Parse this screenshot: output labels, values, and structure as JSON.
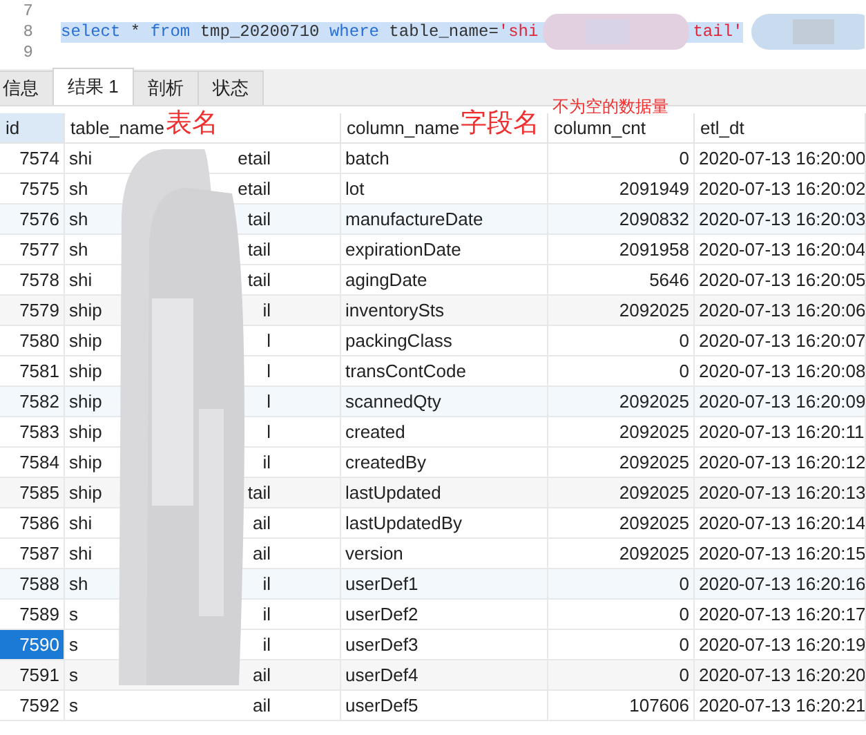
{
  "editor": {
    "lines": [
      {
        "number": "7"
      },
      {
        "number": "8",
        "selected": true,
        "redacted": true,
        "parts": [
          {
            "kind": "keyword",
            "text": "select"
          },
          {
            "kind": "plain",
            "text": " * "
          },
          {
            "kind": "keyword",
            "text": "from"
          },
          {
            "kind": "plain",
            "text": " tmp_20200710 "
          },
          {
            "kind": "keyword",
            "text": "where"
          },
          {
            "kind": "plain",
            "text": " table_name="
          },
          {
            "kind": "string",
            "text": "'shi"
          },
          {
            "kind": "gap"
          },
          {
            "kind": "string",
            "text": "tail'"
          }
        ]
      },
      {
        "number": "9"
      }
    ]
  },
  "tabs": [
    {
      "label": "信息",
      "selected": false
    },
    {
      "label": "结果 1",
      "selected": true
    },
    {
      "label": "剖析",
      "selected": false
    },
    {
      "label": "状态",
      "selected": false
    }
  ],
  "table": {
    "redacted": true,
    "columns": [
      {
        "label": "id",
        "selected": true
      },
      {
        "label": "table_name",
        "selected": false,
        "annotation": "表名"
      },
      {
        "label": "column_name",
        "selected": false,
        "annotation": "字段名"
      },
      {
        "label": "column_cnt",
        "selected": false,
        "note": "不为空的数据量"
      },
      {
        "label": "etl_dt",
        "selected": false
      }
    ],
    "rows": [
      {
        "id": "7574",
        "table_name": [
          "shi",
          "etail"
        ],
        "column_name": "batch",
        "column_cnt": "0",
        "etl_dt": "2020-07-13 16:20:00",
        "selected": false
      },
      {
        "id": "7575",
        "table_name": [
          "sh",
          "etail"
        ],
        "column_name": "lot",
        "column_cnt": "2091949",
        "etl_dt": "2020-07-13 16:20:02",
        "selected": false
      },
      {
        "id": "7576",
        "table_name": [
          "sh",
          "tail"
        ],
        "column_name": "manufactureDate",
        "column_cnt": "2090832",
        "etl_dt": "2020-07-13 16:20:03",
        "selected": false
      },
      {
        "id": "7577",
        "table_name": [
          "sh",
          "tail"
        ],
        "column_name": "expirationDate",
        "column_cnt": "2091958",
        "etl_dt": "2020-07-13 16:20:04",
        "selected": false
      },
      {
        "id": "7578",
        "table_name": [
          "shi",
          "tail"
        ],
        "column_name": "agingDate",
        "column_cnt": "5646",
        "etl_dt": "2020-07-13 16:20:05",
        "selected": false
      },
      {
        "id": "7579",
        "table_name": [
          "ship",
          "il"
        ],
        "column_name": "inventorySts",
        "column_cnt": "2092025",
        "etl_dt": "2020-07-13 16:20:06",
        "selected": false
      },
      {
        "id": "7580",
        "table_name": [
          "ship",
          "l"
        ],
        "column_name": "packingClass",
        "column_cnt": "0",
        "etl_dt": "2020-07-13 16:20:07",
        "selected": false
      },
      {
        "id": "7581",
        "table_name": [
          "ship",
          "l"
        ],
        "column_name": "transContCode",
        "column_cnt": "0",
        "etl_dt": "2020-07-13 16:20:08",
        "selected": false
      },
      {
        "id": "7582",
        "table_name": [
          "ship",
          "l"
        ],
        "column_name": "scannedQty",
        "column_cnt": "2092025",
        "etl_dt": "2020-07-13 16:20:09",
        "selected": false
      },
      {
        "id": "7583",
        "table_name": [
          "ship",
          "l"
        ],
        "column_name": "created",
        "column_cnt": "2092025",
        "etl_dt": "2020-07-13 16:20:11",
        "selected": false
      },
      {
        "id": "7584",
        "table_name": [
          "ship",
          "il"
        ],
        "column_name": "createdBy",
        "column_cnt": "2092025",
        "etl_dt": "2020-07-13 16:20:12",
        "selected": false
      },
      {
        "id": "7585",
        "table_name": [
          "ship",
          "tail"
        ],
        "column_name": "lastUpdated",
        "column_cnt": "2092025",
        "etl_dt": "2020-07-13 16:20:13",
        "selected": false
      },
      {
        "id": "7586",
        "table_name": [
          "shi",
          "ail"
        ],
        "column_name": "lastUpdatedBy",
        "column_cnt": "2092025",
        "etl_dt": "2020-07-13 16:20:14",
        "selected": false
      },
      {
        "id": "7587",
        "table_name": [
          "shi",
          "ail"
        ],
        "column_name": "version",
        "column_cnt": "2092025",
        "etl_dt": "2020-07-13 16:20:15",
        "selected": false
      },
      {
        "id": "7588",
        "table_name": [
          "sh",
          "il"
        ],
        "column_name": "userDef1",
        "column_cnt": "0",
        "etl_dt": "2020-07-13 16:20:16",
        "selected": false
      },
      {
        "id": "7589",
        "table_name": [
          "s",
          "il"
        ],
        "column_name": "userDef2",
        "column_cnt": "0",
        "etl_dt": "2020-07-13 16:20:17",
        "selected": false
      },
      {
        "id": "7590",
        "table_name": [
          "s",
          "il"
        ],
        "column_name": "userDef3",
        "column_cnt": "0",
        "etl_dt": "2020-07-13 16:20:19",
        "selected": true
      },
      {
        "id": "7591",
        "table_name": [
          "s",
          "ail"
        ],
        "column_name": "userDef4",
        "column_cnt": "0",
        "etl_dt": "2020-07-13 16:20:20",
        "selected": false
      },
      {
        "id": "7592",
        "table_name": [
          "s",
          "ail"
        ],
        "column_name": "userDef5",
        "column_cnt": "107606",
        "etl_dt": "2020-07-13 16:20:21",
        "selected": false
      }
    ]
  }
}
